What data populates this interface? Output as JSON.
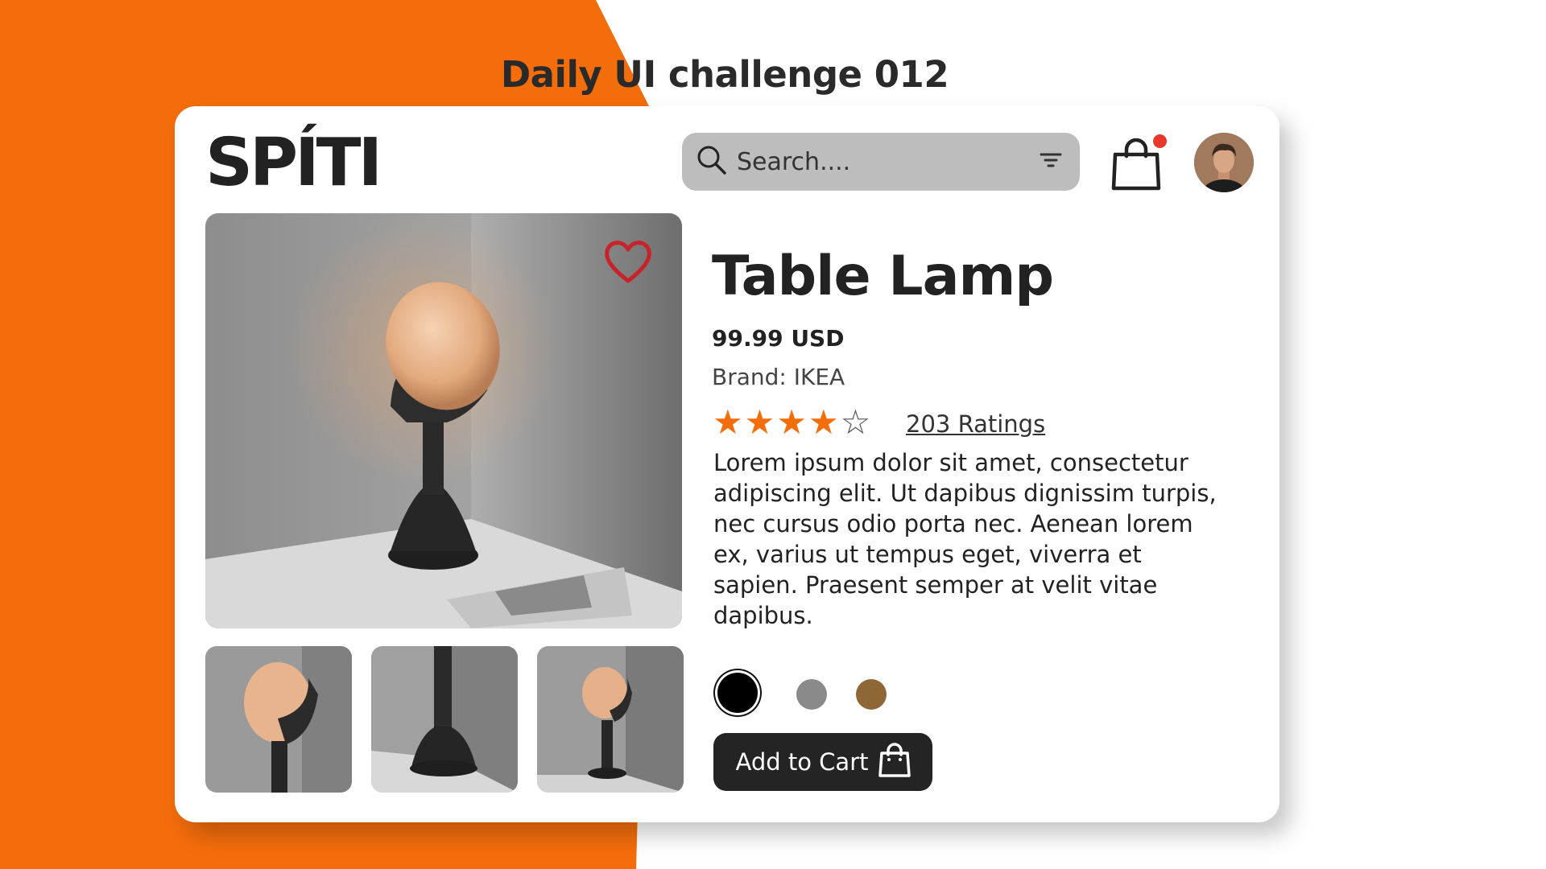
{
  "heading": "Daily UI challenge 012",
  "header": {
    "logo": "SPÍTI",
    "search_placeholder": "Search....",
    "cart_has_notification": true
  },
  "product": {
    "title": "Table Lamp",
    "price": "99.99 USD",
    "brand": "Brand: IKEA",
    "rating": 4,
    "rating_max": 5,
    "ratings_label": "203 Ratings",
    "description": "Lorem ipsum dolor sit amet, consectetur adipiscing elit. Ut dapibus dignissim turpis, nec cursus odio porta nec. Aenean lorem ex, varius ut tempus eget, viverra et sapien. Praesent semper at velit vitae dapibus.",
    "colors": [
      "#000000",
      "#8a8a8a",
      "#8f6736"
    ],
    "selected_color": 0,
    "favorite": false
  },
  "actions": {
    "add_to_cart": "Add to Cart"
  },
  "theme": {
    "accent": "#f46d0b",
    "heart": "#c8222a",
    "notification": "#e8382c",
    "button_dark": "#242424"
  }
}
